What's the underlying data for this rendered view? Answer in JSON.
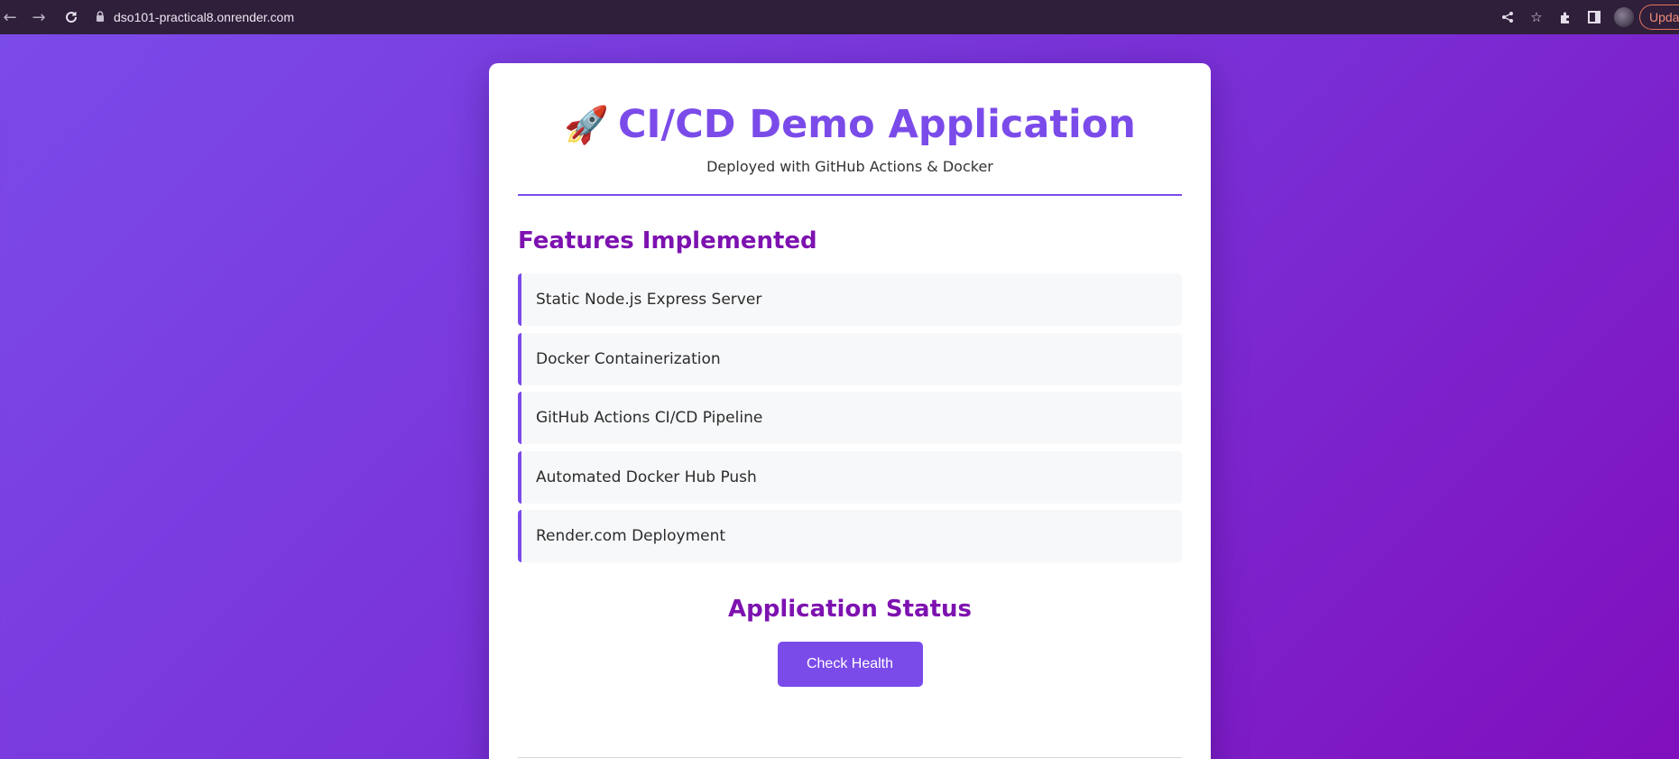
{
  "browser": {
    "url": "dso101-practical8.onrender.com",
    "update_label": "Update"
  },
  "page": {
    "title": "CI/CD Demo Application",
    "title_emoji": "🚀",
    "subtitle": "Deployed with GitHub Actions & Docker",
    "features_heading": "Features Implemented",
    "features": [
      "Static Node.js Express Server",
      "Docker Containerization",
      "GitHub Actions CI/CD Pipeline",
      "Automated Docker Hub Push",
      "Render.com Deployment"
    ],
    "status_heading": "Application Status",
    "check_button": "Check Health"
  },
  "colors": {
    "accent": "#7b4bea",
    "heading": "#7d12b0"
  }
}
